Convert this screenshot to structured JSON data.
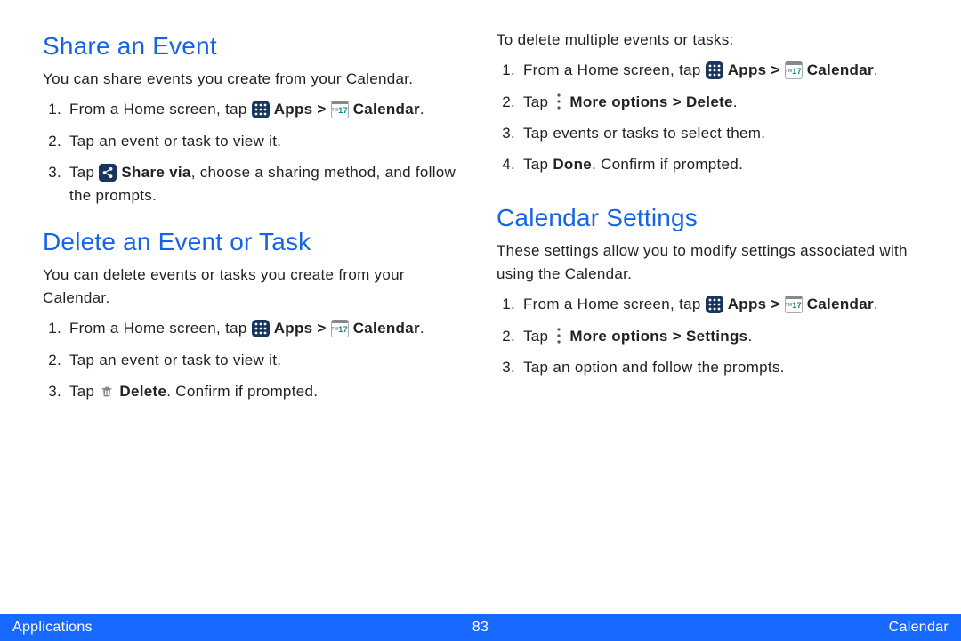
{
  "icon_text": {
    "calendar_day": "17",
    "calendar_tm": "TM"
  },
  "left": {
    "section1": {
      "heading": "Share an Event",
      "desc": "You can share events you create from your Calendar.",
      "steps": {
        "s1": {
          "pre": "From a Home screen, tap ",
          "apps_label": "Apps > ",
          "cal_label": "Calendar",
          "post": "."
        },
        "s2": "Tap an event or task to view it.",
        "s3": {
          "pre": "Tap ",
          "bold": "Share via",
          "post": ", choose a sharing method, and follow the prompts."
        }
      }
    },
    "section2": {
      "heading": "Delete an Event or Task",
      "desc": "You can delete events or tasks you create from your Calendar.",
      "steps": {
        "s1": {
          "pre": "From a Home screen, tap ",
          "apps_label": "Apps > ",
          "cal_label": "Calendar",
          "post": "."
        },
        "s2": "Tap an event or task to view it.",
        "s3": {
          "pre": "Tap ",
          "bold": "Delete",
          "post": ". Confirm if prompted."
        }
      }
    }
  },
  "right": {
    "intro": "To delete multiple events or tasks:",
    "steps_a": {
      "s1": {
        "pre": "From a Home screen, tap ",
        "apps_label": "Apps > ",
        "cal_label": "Calendar",
        "post": "."
      },
      "s2": {
        "pre": "Tap ",
        "bold": "More options > Delete",
        "post": "."
      },
      "s3": "Tap events or tasks to select them.",
      "s4": {
        "pre": "Tap ",
        "bold": "Done",
        "post": ". Confirm if prompted."
      }
    },
    "section2": {
      "heading": "Calendar Settings",
      "desc": "These settings allow you to modify settings associated with using the Calendar.",
      "steps": {
        "s1": {
          "pre": "From a Home screen, tap ",
          "apps_label": "Apps > ",
          "cal_label": "Calendar",
          "post": "."
        },
        "s2": {
          "pre": "Tap ",
          "bold": "More options > Settings",
          "post": "."
        },
        "s3": "Tap an option and follow the prompts."
      }
    }
  },
  "footer": {
    "left": "Applications",
    "center": "83",
    "right": "Calendar"
  }
}
